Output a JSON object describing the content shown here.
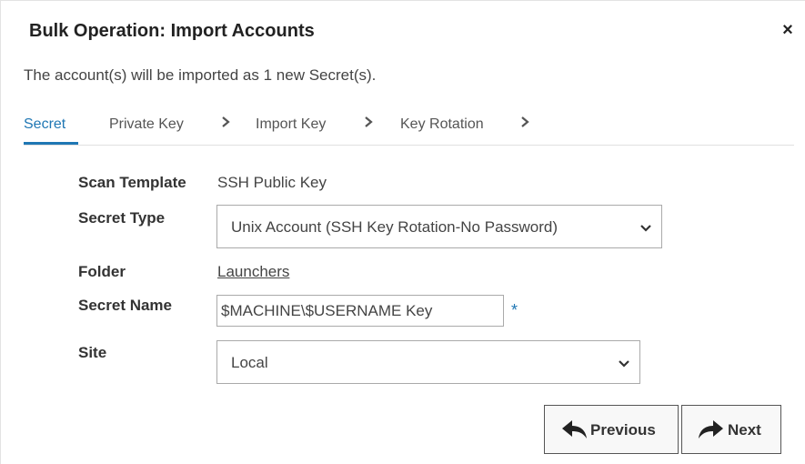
{
  "dialog": {
    "title": "Bulk Operation: Import Accounts",
    "close_icon": "×",
    "intro": "The account(s) will be imported as 1 new Secret(s)."
  },
  "tabs": [
    {
      "label": "Secret",
      "active": true
    },
    {
      "label": "Private Key"
    },
    {
      "label": "Import Key"
    },
    {
      "label": "Key Rotation"
    }
  ],
  "chevron": "›",
  "form": {
    "scan_template_label": "Scan Template",
    "scan_template_value": "SSH Public Key",
    "secret_type_label": "Secret Type",
    "secret_type_value": "Unix Account (SSH Key Rotation-No Password)",
    "folder_label": "Folder",
    "folder_value": "Launchers",
    "secret_name_label": "Secret Name",
    "secret_name_value": "$MACHINE\\$USERNAME Key",
    "required_marker": "*",
    "site_label": "Site",
    "site_value": "Local"
  },
  "buttons": {
    "previous_label": "Previous",
    "next_label": "Next"
  },
  "colors": {
    "accent": "#1f77b4",
    "text": "#333333",
    "border": "#aaaaaa"
  }
}
